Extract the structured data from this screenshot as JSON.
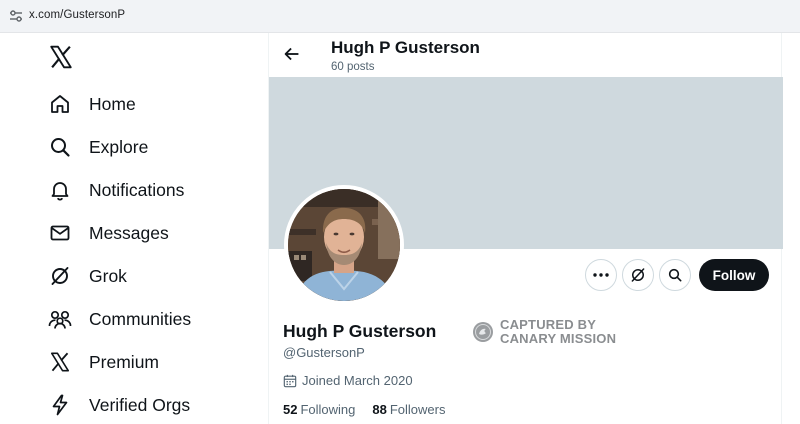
{
  "browser": {
    "url": "x.com/GustersonP"
  },
  "sidebar": {
    "items": [
      {
        "label": "Home",
        "icon": "home-icon"
      },
      {
        "label": "Explore",
        "icon": "search-icon"
      },
      {
        "label": "Notifications",
        "icon": "bell-icon"
      },
      {
        "label": "Messages",
        "icon": "envelope-icon"
      },
      {
        "label": "Grok",
        "icon": "grok-icon"
      },
      {
        "label": "Communities",
        "icon": "people-icon"
      },
      {
        "label": "Premium",
        "icon": "x-icon"
      },
      {
        "label": "Verified Orgs",
        "icon": "lightning-icon"
      }
    ]
  },
  "header": {
    "name": "Hugh P Gusterson",
    "post_count": "60 posts"
  },
  "profile": {
    "name": "Hugh P Gusterson",
    "handle": "@GustersonP",
    "joined": "Joined March 2020",
    "following_count": "52",
    "following_label": "Following",
    "followers_count": "88",
    "followers_label": "Followers",
    "follow_label": "Follow"
  },
  "watermark": {
    "line1": "CAPTURED BY",
    "line2": "CANARY MISSION"
  },
  "colors": {
    "banner": "#cfd9de",
    "text": "#0f1419",
    "secondary": "#536471",
    "follow_bg": "#0f1419"
  }
}
